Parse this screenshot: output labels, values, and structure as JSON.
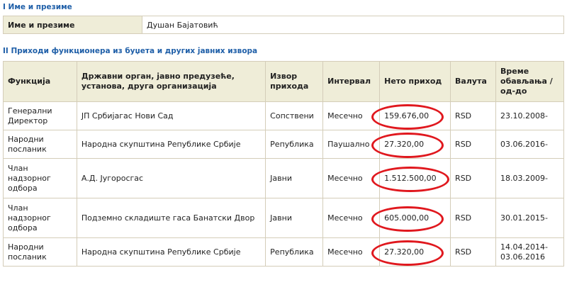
{
  "section1": {
    "title": "I Име и презиме",
    "label": "Име и презиме",
    "value": "Душан Бајатовић"
  },
  "section2": {
    "title": "II Приходи функционера из буџета и других јавних извора",
    "headers": {
      "function": "Функција",
      "organ": "Државни орган, јавно предузеће, установа, друга организација",
      "source": "Извор прихода",
      "interval": "Интервал",
      "net": "Нето приход",
      "currency": "Валута",
      "period": "Време обављања / од-до"
    },
    "rows": [
      {
        "function": "Генерални Директор",
        "organ": "ЈП Србијагас Нови Сад",
        "source": "Сопствени",
        "interval": "Месечно",
        "net": "159.676,00",
        "currency": "RSD",
        "period": "23.10.2008-"
      },
      {
        "function": "Народни посланик",
        "organ": "Народна скупштина Републике Србије",
        "source": "Република",
        "interval": "Паушално",
        "net": "27.320,00",
        "currency": "RSD",
        "period": "03.06.2016-"
      },
      {
        "function": "Члан надзорног одбора",
        "organ": "А.Д. Југоросгас",
        "source": "Јавни",
        "interval": "Месечно",
        "net": "1.512.500,00",
        "currency": "RSD",
        "period": "18.03.2009-"
      },
      {
        "function": "Члан надзорног одбора",
        "organ": "Подземно складиште гаса Банатски Двор",
        "source": "Јавни",
        "interval": "Месечно",
        "net": "605.000,00",
        "currency": "RSD",
        "period": "30.01.2015-"
      },
      {
        "function": "Народни посланик",
        "organ": "Народна скупштина Републике Србије",
        "source": "Република",
        "interval": "Месечно",
        "net": "27.320,00",
        "currency": "RSD",
        "period": "14.04.2014-\n03.06.2016"
      }
    ]
  },
  "annotation": {
    "color": "#e0181e"
  }
}
